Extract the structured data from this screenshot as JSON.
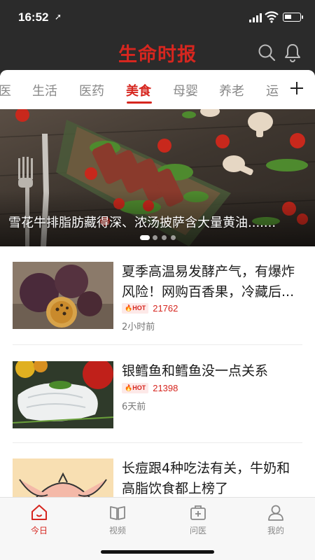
{
  "status_bar": {
    "time": "16:52",
    "location_icon": "location-arrow-icon",
    "signal_icon": "cellular-signal-icon",
    "wifi_icon": "wifi-icon",
    "battery_icon": "battery-icon"
  },
  "header": {
    "brand": "生命时报",
    "search_icon": "search-icon",
    "notification_icon": "bell-icon"
  },
  "tabs": {
    "items": [
      {
        "label": "医"
      },
      {
        "label": "生活"
      },
      {
        "label": "医药"
      },
      {
        "label": "美食",
        "active": true
      },
      {
        "label": "母婴"
      },
      {
        "label": "养老"
      },
      {
        "label": "运"
      }
    ],
    "add_icon": "plus-icon"
  },
  "banner": {
    "title": "雪花牛排脂肪藏得深、浓汤披萨含大量黄油.......",
    "slide_count": 4,
    "active_slide": 0
  },
  "articles": [
    {
      "title": "夏季高温易发酵产气，有爆炸风险！网购百香果，冷藏后...",
      "hot_label": "HOT",
      "hot_count": "21762",
      "time": "2小时前",
      "thumb": "passion-fruit-photo"
    },
    {
      "title": "银鳕鱼和鳕鱼没一点关系",
      "hot_label": "HOT",
      "hot_count": "21398",
      "time": "6天前",
      "thumb": "cod-fish-photo"
    },
    {
      "title": "长痘跟4种吃法有关，牛奶和高脂饮食都上榜了",
      "thumb": "acne-illustration"
    }
  ],
  "bottom_nav": {
    "items": [
      {
        "label": "今日",
        "icon": "home-icon",
        "active": true
      },
      {
        "label": "视频",
        "icon": "book-icon"
      },
      {
        "label": "问医",
        "icon": "medical-kit-icon"
      },
      {
        "label": "我的",
        "icon": "user-icon"
      }
    ]
  },
  "colors": {
    "accent": "#d6261f",
    "header_bg": "#2b2b2b",
    "inactive_text": "#888888"
  }
}
